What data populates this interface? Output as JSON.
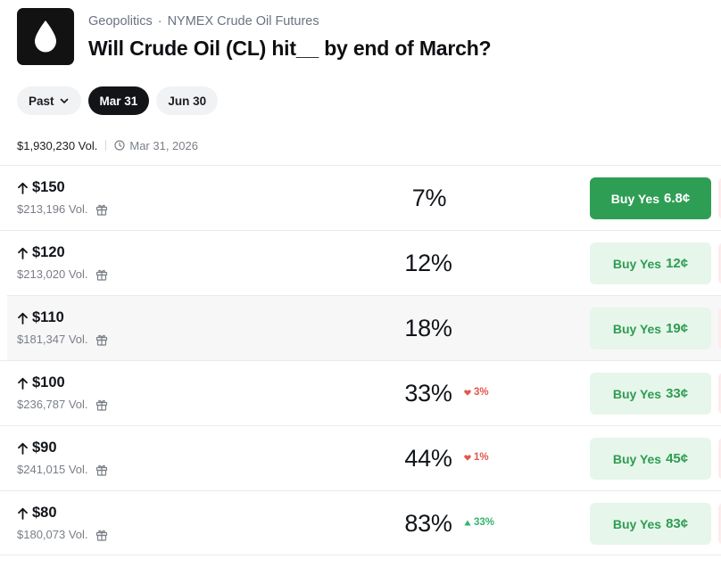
{
  "header": {
    "breadcrumb": [
      "Geopolitics",
      "NYMEX Crude Oil Futures"
    ],
    "breadcrumb_sep": "·",
    "title": "Will Crude Oil (CL) hit__ by end of March?"
  },
  "tabs": [
    {
      "label": "Past",
      "active": false,
      "dropdown": true
    },
    {
      "label": "Mar 31",
      "active": true
    },
    {
      "label": "Jun 30",
      "active": false
    }
  ],
  "meta": {
    "volume": "$1,930,230 Vol.",
    "date": "Mar 31, 2026"
  },
  "markets": [
    {
      "label": "$150",
      "volume": "$213,196 Vol.",
      "percent": "7%",
      "delta": "",
      "delta_dir": "",
      "buy_label": "Buy Yes",
      "buy_price": "6.8¢",
      "buy_style": "solid"
    },
    {
      "label": "$120",
      "volume": "$213,020 Vol.",
      "percent": "12%",
      "delta": "",
      "delta_dir": "",
      "buy_label": "Buy Yes",
      "buy_price": "12¢",
      "buy_style": "light"
    },
    {
      "label": "$110",
      "volume": "$181,347 Vol.",
      "percent": "18%",
      "delta": "",
      "delta_dir": "",
      "buy_label": "Buy Yes",
      "buy_price": "19¢",
      "buy_style": "light"
    },
    {
      "label": "$100",
      "volume": "$236,787 Vol.",
      "percent": "33%",
      "delta": "3%",
      "delta_dir": "down",
      "buy_label": "Buy Yes",
      "buy_price": "33¢",
      "buy_style": "light"
    },
    {
      "label": "$90",
      "volume": "$241,015 Vol.",
      "percent": "44%",
      "delta": "1%",
      "delta_dir": "down",
      "buy_label": "Buy Yes",
      "buy_price": "45¢",
      "buy_style": "light"
    },
    {
      "label": "$80",
      "volume": "$180,073 Vol.",
      "percent": "83%",
      "delta": "33%",
      "delta_dir": "up",
      "buy_label": "Buy Yes",
      "buy_price": "83¢",
      "buy_style": "light"
    }
  ],
  "icons": {
    "logo": "oil-drop-icon",
    "clock": "clock-icon",
    "arrow": "arrow-up-icon",
    "gift": "gift-icon",
    "chevron": "chevron-down-icon"
  },
  "colors": {
    "accent_green": "#2f9e55",
    "light_green": "#e6f6ea",
    "down_red": "#e2574c",
    "up_green": "#34b36b"
  }
}
